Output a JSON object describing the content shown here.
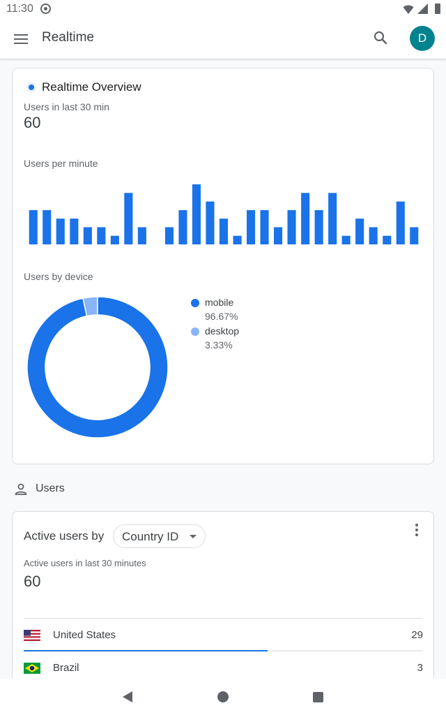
{
  "status_bar": {
    "time": "11:30"
  },
  "app_bar": {
    "title": "Realtime",
    "avatar_initial": "D"
  },
  "overview": {
    "title": "Realtime Overview",
    "users_label": "Users in last 30 min",
    "users_value": "60",
    "per_minute_label": "Users per minute",
    "device_label": "Users by device"
  },
  "chart_data": [
    {
      "type": "bar",
      "values": [
        4,
        4,
        3,
        3,
        2,
        2,
        1,
        6,
        2,
        0,
        2,
        4,
        7,
        5,
        3,
        1,
        4,
        4,
        2,
        4,
        6,
        4,
        6,
        1,
        3,
        2,
        1,
        5,
        2
      ],
      "color": "#1a73e8"
    },
    {
      "type": "pie",
      "series": [
        {
          "name": "mobile",
          "value": 96.67,
          "label": "96.67%",
          "color": "#1a73e8"
        },
        {
          "name": "desktop",
          "value": 3.33,
          "label": "3.33%",
          "color": "#8ab4f8"
        }
      ]
    }
  ],
  "users_section": {
    "title": "Users",
    "card_title": "Active users by",
    "dimension": "Country ID",
    "metric_label": "Active users in last 30 minutes",
    "metric_value": "60",
    "rows": [
      {
        "country": "United States",
        "value": "29",
        "share": 0.61
      },
      {
        "country": "Brazil",
        "value": "3",
        "share": 0.06
      }
    ]
  },
  "colors": {
    "accent": "#1a73e8",
    "avatar": "#00838f"
  }
}
